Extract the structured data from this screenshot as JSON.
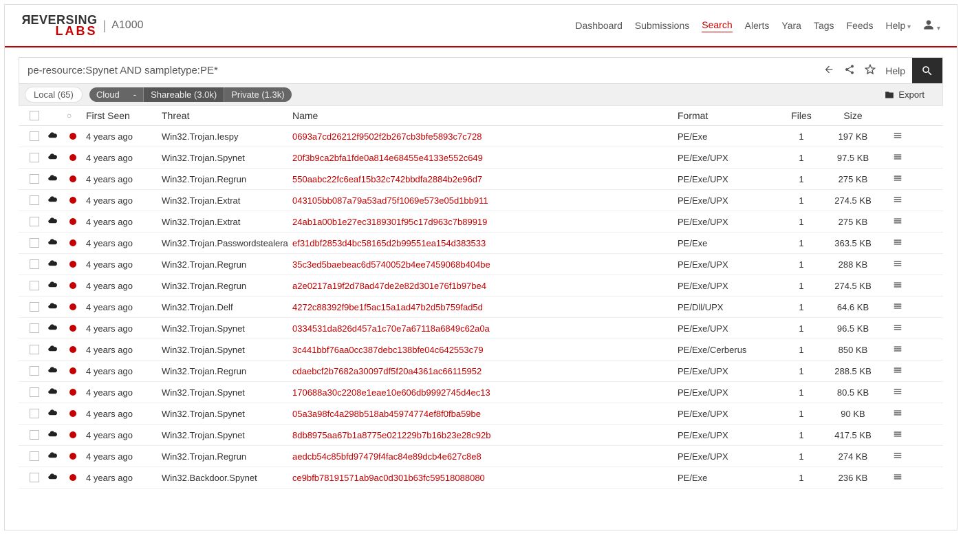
{
  "brand": {
    "product": "A1000"
  },
  "nav": {
    "dashboard": "Dashboard",
    "submissions": "Submissions",
    "search": "Search",
    "alerts": "Alerts",
    "yara": "Yara",
    "tags": "Tags",
    "feeds": "Feeds",
    "help": "Help"
  },
  "search": {
    "query": "pe-resource:Spynet AND sampletype:PE*",
    "help": "Help"
  },
  "filter": {
    "local": "Local (65)",
    "cloud": "Cloud",
    "dash": "-",
    "shareable": "Shareable (3.0k)",
    "private": "Private (1.3k)",
    "export": "Export"
  },
  "columns": {
    "first_seen": "First Seen",
    "threat": "Threat",
    "name": "Name",
    "format": "Format",
    "files": "Files",
    "size": "Size"
  },
  "rows": [
    {
      "first_seen": "4 years ago",
      "threat": "Win32.Trojan.Iespy",
      "name": "0693a7cd26212f9502f2b267cb3bfe5893c7c728",
      "format": "PE/Exe",
      "files": "1",
      "size": "197 KB"
    },
    {
      "first_seen": "4 years ago",
      "threat": "Win32.Trojan.Spynet",
      "name": "20f3b9ca2bfa1fde0a814e68455e4133e552c649",
      "format": "PE/Exe/UPX",
      "files": "1",
      "size": "97.5 KB"
    },
    {
      "first_seen": "4 years ago",
      "threat": "Win32.Trojan.Regrun",
      "name": "550aabc22fc6eaf15b32c742bbdfa2884b2e96d7",
      "format": "PE/Exe/UPX",
      "files": "1",
      "size": "275 KB"
    },
    {
      "first_seen": "4 years ago",
      "threat": "Win32.Trojan.Extrat",
      "name": "043105bb087a79a53ad75f1069e573e05d1bb911",
      "format": "PE/Exe/UPX",
      "files": "1",
      "size": "274.5 KB"
    },
    {
      "first_seen": "4 years ago",
      "threat": "Win32.Trojan.Extrat",
      "name": "24ab1a00b1e27ec3189301f95c17d963c7b89919",
      "format": "PE/Exe/UPX",
      "files": "1",
      "size": "275 KB"
    },
    {
      "first_seen": "4 years ago",
      "threat": "Win32.Trojan.Passwordstealera",
      "name": "ef31dbf2853d4bc58165d2b99551ea154d383533",
      "format": "PE/Exe",
      "files": "1",
      "size": "363.5 KB"
    },
    {
      "first_seen": "4 years ago",
      "threat": "Win32.Trojan.Regrun",
      "name": "35c3ed5baebeac6d5740052b4ee7459068b404be",
      "format": "PE/Exe/UPX",
      "files": "1",
      "size": "288 KB"
    },
    {
      "first_seen": "4 years ago",
      "threat": "Win32.Trojan.Regrun",
      "name": "a2e0217a19f2d78ad47de2e82d301e76f1b97be4",
      "format": "PE/Exe/UPX",
      "files": "1",
      "size": "274.5 KB"
    },
    {
      "first_seen": "4 years ago",
      "threat": "Win32.Trojan.Delf",
      "name": "4272c88392f9be1f5ac15a1ad47b2d5b759fad5d",
      "format": "PE/Dll/UPX",
      "files": "1",
      "size": "64.6 KB"
    },
    {
      "first_seen": "4 years ago",
      "threat": "Win32.Trojan.Spynet",
      "name": "0334531da826d457a1c70e7a67118a6849c62a0a",
      "format": "PE/Exe/UPX",
      "files": "1",
      "size": "96.5 KB"
    },
    {
      "first_seen": "4 years ago",
      "threat": "Win32.Trojan.Spynet",
      "name": "3c441bbf76aa0cc387debc138bfe04c642553c79",
      "format": "PE/Exe/Cerberus",
      "files": "1",
      "size": "850 KB"
    },
    {
      "first_seen": "4 years ago",
      "threat": "Win32.Trojan.Regrun",
      "name": "cdaebcf2b7682a30097df5f20a4361ac66115952",
      "format": "PE/Exe/UPX",
      "files": "1",
      "size": "288.5 KB"
    },
    {
      "first_seen": "4 years ago",
      "threat": "Win32.Trojan.Spynet",
      "name": "170688a30c2208e1eae10e606db9992745d4ec13",
      "format": "PE/Exe/UPX",
      "files": "1",
      "size": "80.5 KB"
    },
    {
      "first_seen": "4 years ago",
      "threat": "Win32.Trojan.Spynet",
      "name": "05a3a98fc4a298b518ab45974774ef8f0fba59be",
      "format": "PE/Exe/UPX",
      "files": "1",
      "size": "90 KB"
    },
    {
      "first_seen": "4 years ago",
      "threat": "Win32.Trojan.Spynet",
      "name": "8db8975aa67b1a8775e021229b7b16b23e28c92b",
      "format": "PE/Exe/UPX",
      "files": "1",
      "size": "417.5 KB"
    },
    {
      "first_seen": "4 years ago",
      "threat": "Win32.Trojan.Regrun",
      "name": "aedcb54c85bfd97479f4fac84e89dcb4e627c8e8",
      "format": "PE/Exe/UPX",
      "files": "1",
      "size": "274 KB"
    },
    {
      "first_seen": "4 years ago",
      "threat": "Win32.Backdoor.Spynet",
      "name": "ce9bfb78191571ab9ac0d301b63fc59518088080",
      "format": "PE/Exe",
      "files": "1",
      "size": "236 KB"
    }
  ]
}
